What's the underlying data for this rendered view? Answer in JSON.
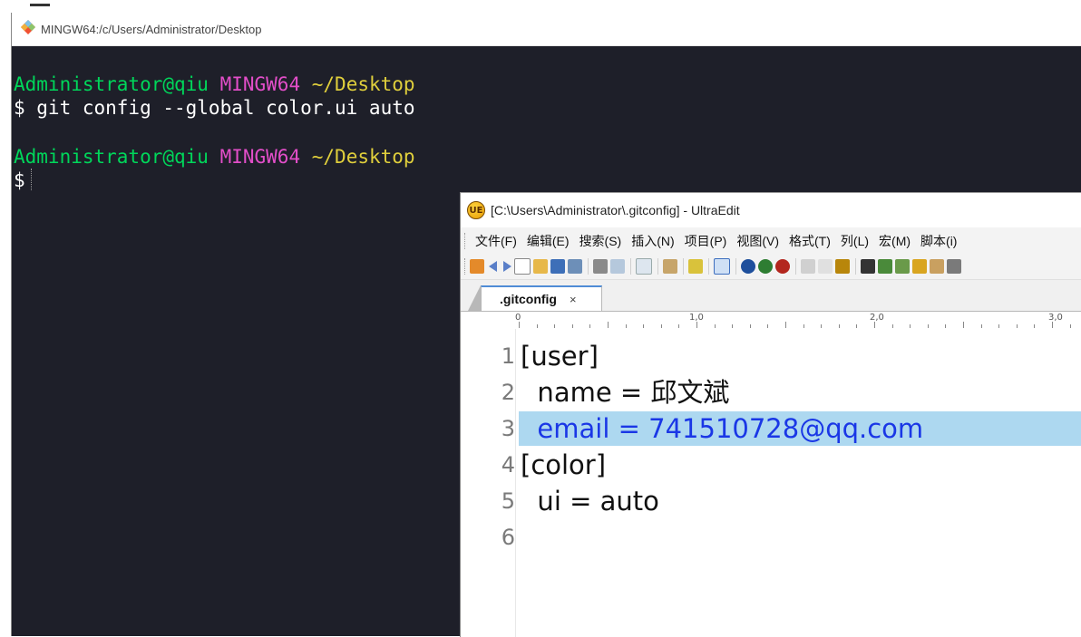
{
  "terminal": {
    "title": "MINGW64:/c/Users/Administrator/Desktop",
    "lines": [
      {
        "user": "Administrator@qiu",
        "host": "MINGW64",
        "path": "~/Desktop"
      },
      {
        "cmd": "$ git config --global color.ui auto"
      },
      {
        "user": "Administrator@qiu",
        "host": "MINGW64",
        "path": "~/Desktop"
      },
      {
        "cmd": "$"
      }
    ],
    "colors": {
      "user": "#00d65a",
      "host": "#e34ec9",
      "path": "#e0cf3c",
      "background": "#1e1f29"
    }
  },
  "ultraedit": {
    "title": "[C:\\Users\\Administrator\\.gitconfig] - UltraEdit",
    "logo_icon": "ultraedit-logo-icon",
    "menu": [
      "文件(F)",
      "编辑(E)",
      "搜索(S)",
      "插入(N)",
      "项目(P)",
      "视图(V)",
      "格式(T)",
      "列(L)",
      "宏(M)",
      "脚本(i)"
    ],
    "toolbar_icons": [
      "new-icon",
      "back-arrow-icon",
      "forward-arrow-icon",
      "new-file-icon",
      "open-icon",
      "close-file-icon",
      "save-icon",
      "print-icon",
      "print-preview-icon",
      "properties-icon",
      "word-wrap-icon",
      "column-mode-icon",
      "hex-icon",
      "ftp-icon",
      "ue-online-icon",
      "ue-update-icon",
      "cut-icon",
      "copy-icon",
      "paste-icon",
      "find-icon",
      "find-next-icon",
      "replace-icon",
      "replace-all-icon",
      "save-all-icon",
      "more-icon"
    ],
    "tab": {
      "label": ".gitconfig",
      "close": "×"
    },
    "ruler": [
      "0",
      "1,0",
      "2,0",
      "3,0"
    ],
    "editor": {
      "current_line": 3,
      "highlight_color": "#add8f0",
      "lines": [
        {
          "num": "1",
          "text": "[user]"
        },
        {
          "num": "2",
          "text": "  name = 邱文斌"
        },
        {
          "num": "3",
          "text": "  email = 741510728@qq.com"
        },
        {
          "num": "4",
          "text": "[color]"
        },
        {
          "num": "5",
          "text": "  ui = auto"
        },
        {
          "num": "6",
          "text": ""
        }
      ]
    }
  }
}
